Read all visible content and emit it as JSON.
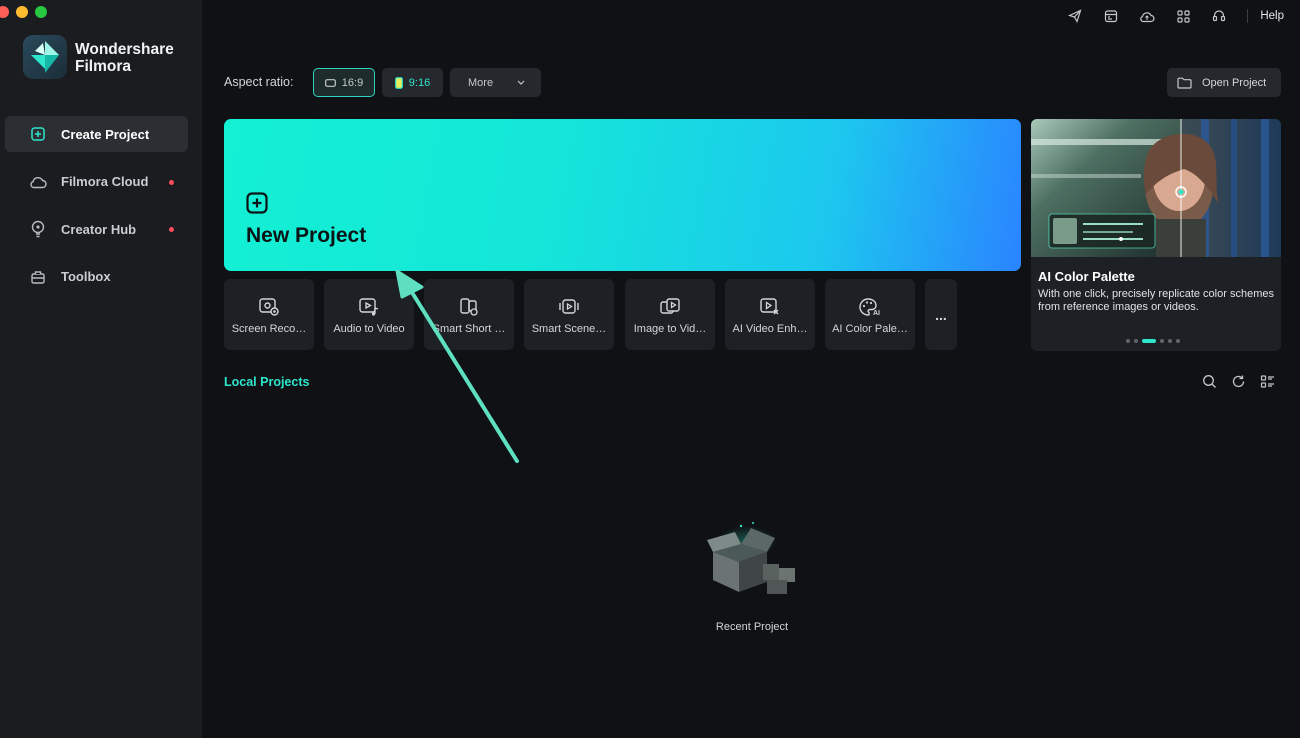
{
  "app": {
    "brand_line1": "Wondershare",
    "brand_line2": "Filmora"
  },
  "sidebar": {
    "items": [
      {
        "label": "Create Project",
        "icon": "plus-square-icon",
        "active": true,
        "badge": false
      },
      {
        "label": "Filmora Cloud",
        "icon": "cloud-icon",
        "active": false,
        "badge": true
      },
      {
        "label": "Creator Hub",
        "icon": "lightbulb-icon",
        "active": false,
        "badge": true
      },
      {
        "label": "Toolbox",
        "icon": "toolbox-icon",
        "active": false,
        "badge": false
      }
    ]
  },
  "topbar": {
    "icons": [
      "send-icon",
      "calendar-icon",
      "cloud-sync-icon",
      "grid-icon",
      "headset-icon"
    ],
    "help_label": "Help"
  },
  "aspect": {
    "label": "Aspect ratio:",
    "options": [
      "16:9",
      "9:16"
    ],
    "selected": "16:9",
    "more_label": "More"
  },
  "open_project_label": "Open Project",
  "new_project": {
    "label": "New Project"
  },
  "tools": [
    {
      "label": "Screen Reco…",
      "icon": "screen-record-icon"
    },
    {
      "label": "Audio to Video",
      "icon": "audio-to-video-icon"
    },
    {
      "label": "Smart Short …",
      "icon": "smart-short-icon"
    },
    {
      "label": "Smart Scene…",
      "icon": "smart-scene-icon"
    },
    {
      "label": "Image to Vid…",
      "icon": "image-to-video-icon"
    },
    {
      "label": "AI Video Enh…",
      "icon": "ai-video-enhance-icon"
    },
    {
      "label": "AI Color Pale…",
      "icon": "ai-color-palette-icon"
    }
  ],
  "more_tools_label": "...",
  "feature": {
    "title": "AI Color Palette",
    "description": "With one click, precisely replicate color schemes from reference images or videos.",
    "slide_count": 6,
    "active_slide": 2
  },
  "local_projects": {
    "title": "Local Projects",
    "tool_icons": [
      "search-icon",
      "refresh-icon",
      "list-view-icon"
    ],
    "empty_label": "Recent Project"
  },
  "colors": {
    "accent": "#2ee6cc",
    "badge": "#ff4d5e",
    "background": "#0f1114",
    "sidebar": "#1a1c20"
  }
}
